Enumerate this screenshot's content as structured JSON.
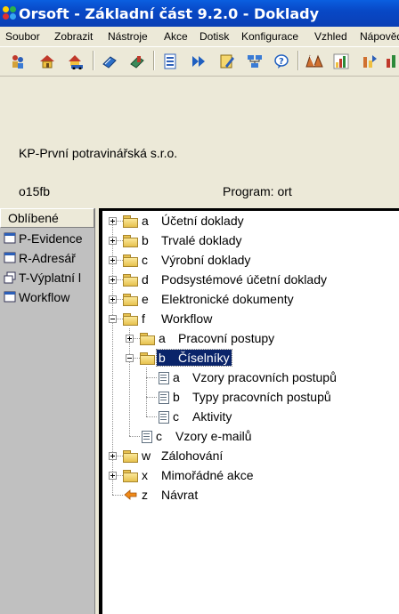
{
  "window": {
    "title": "Orsoft - Základní část 9.2.0 - Doklady"
  },
  "menu": [
    "Soubor",
    "Zobrazit",
    "Nástroje",
    "Akce",
    "Dotisk",
    "Konfigurace",
    "Vzhled",
    "Nápověda"
  ],
  "toolbar": {
    "icons": [
      "people-icon",
      "home-icon",
      "home-car-icon",
      "book-icon",
      "bookmark-book-icon",
      "document-list-icon",
      "forward-arrows-icon",
      "pencil-note-icon",
      "network-icon",
      "help-icon",
      "map-icon",
      "chart-grid-icon",
      "chart-arrows-icon",
      "chart-bar-icon"
    ]
  },
  "info": {
    "company": "KP-První potravinářská s.r.o.",
    "code": "o15fb",
    "program": "Program: ort"
  },
  "favorites": {
    "header": "Oblíbené",
    "items": [
      "P-Evidence",
      "R-Adresář",
      "T-Výplatní l",
      "Workflow"
    ]
  },
  "tree": {
    "items": [
      {
        "key": "a",
        "label": "Účetní doklady"
      },
      {
        "key": "b",
        "label": "Trvalé doklady"
      },
      {
        "key": "c",
        "label": "Výrobní doklady"
      },
      {
        "key": "d",
        "label": "Podsystémové účetní doklady"
      },
      {
        "key": "e",
        "label": "Elektronické dokumenty"
      },
      {
        "key": "f",
        "label": "Workflow"
      },
      {
        "key": "a",
        "label": "Pracovní postupy"
      },
      {
        "key": "b",
        "label": "Číselníky"
      },
      {
        "key": "a",
        "label": "Vzory pracovních postupů"
      },
      {
        "key": "b",
        "label": "Typy pracovních postupů"
      },
      {
        "key": "c",
        "label": "Aktivity"
      },
      {
        "key": "c",
        "label": "Vzory e-mailů"
      },
      {
        "key": "w",
        "label": "Zálohování"
      },
      {
        "key": "x",
        "label": "Mimořádné akce"
      },
      {
        "key": "z",
        "label": "Návrat"
      }
    ]
  },
  "colors": {
    "title_bar": "#0a48c6",
    "selection": "#0a246a",
    "favorites_bg": "#c0c0c0",
    "tree_bg": "#ffffff"
  }
}
